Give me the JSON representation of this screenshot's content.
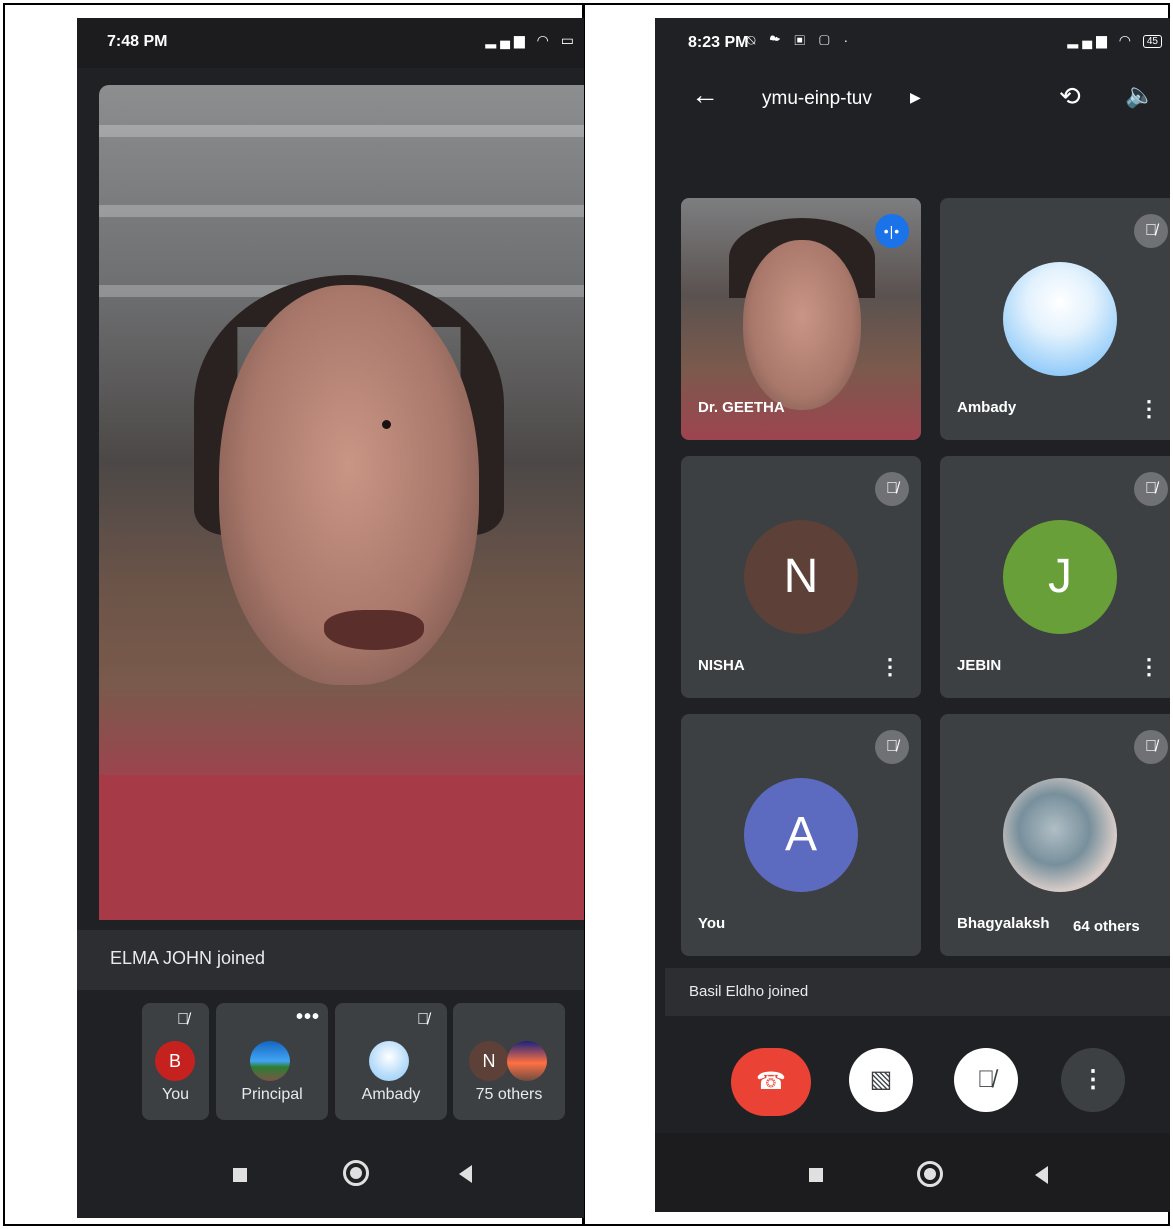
{
  "left_phone": {
    "status_bar": {
      "time": "7:48 PM",
      "icons": "signal wifi battery"
    },
    "main_video": {
      "participant": "speaker"
    },
    "notice": "ELMA JOHN joined",
    "tiles": [
      {
        "label": "You",
        "avatar_letter": "B",
        "avatar_color": "#c5221f",
        "muted": true
      },
      {
        "label": "Principal",
        "avatar_type": "photo",
        "has_menu": true
      },
      {
        "label": "Ambady",
        "avatar_type": "photo",
        "muted": true
      },
      {
        "label": "75 others",
        "avatar_letter": "N"
      }
    ]
  },
  "right_phone": {
    "status_bar": {
      "time": "8:23 PM",
      "battery": "45"
    },
    "meeting_code": "ymu-einp-tuv",
    "tiles": [
      {
        "name": "Dr. GEETHA",
        "type": "video",
        "speaking": true
      },
      {
        "name": "Ambady",
        "type": "photo",
        "muted": true
      },
      {
        "name": "NISHA",
        "avatar_letter": "N",
        "avatar_color": "#5d4037",
        "muted": true
      },
      {
        "name": "JEBIN",
        "avatar_letter": "J",
        "avatar_color": "#689f38",
        "muted": true
      },
      {
        "name": "You",
        "avatar_letter": "A",
        "avatar_color": "#5c6bc0",
        "muted": true
      },
      {
        "name": "Bhagyalaksh",
        "type": "photo",
        "muted": true
      }
    ],
    "others_label": "64 others",
    "notice": "Basil Eldho joined",
    "controls": [
      "end-call",
      "camera-off",
      "mic-off",
      "more-options"
    ]
  }
}
